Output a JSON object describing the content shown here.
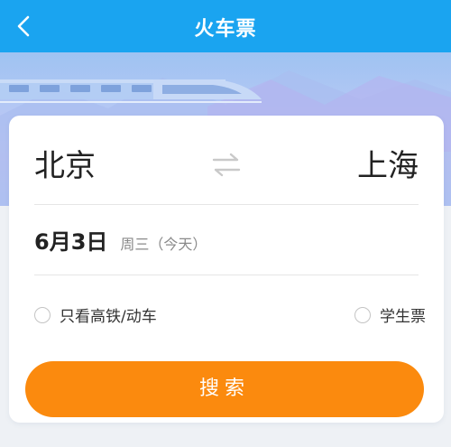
{
  "header": {
    "title": "火车票",
    "back_icon": "chevron-left-icon",
    "background": "#1aa4f0"
  },
  "banner": {
    "image": "high-speed-train-illustration"
  },
  "route": {
    "from": "北京",
    "to": "上海",
    "swap_icon": "swap-arrows-icon"
  },
  "date": {
    "main": "6月3日",
    "sub": "周三（今天）"
  },
  "options": {
    "highspeed_label": "只看高铁/动车",
    "highspeed_checked": false,
    "student_label": "学生票",
    "student_checked": false
  },
  "search": {
    "label": "搜索",
    "color": "#fb8a0e"
  }
}
